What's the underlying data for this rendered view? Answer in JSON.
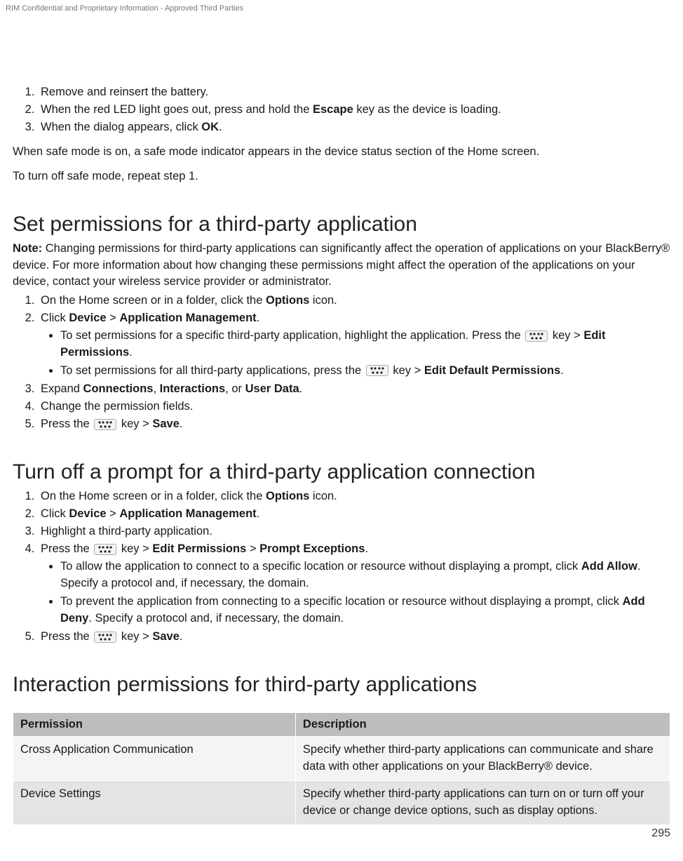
{
  "header": "RIM Confidential and Proprietary Information - Approved Third Parties",
  "footer_page": "295",
  "list1": {
    "i1": "Remove and reinsert the battery.",
    "i2a": "When the red LED light goes out, press and hold the ",
    "i2b": "Escape",
    "i2c": " key as the device is loading.",
    "i3a": "When the dialog appears, click ",
    "i3b": "OK",
    "i3c": "."
  },
  "para1": "When safe mode is on, a safe mode indicator appears in the device status section of the Home screen.",
  "para2": "To turn off safe mode, repeat step 1.",
  "sec2_title": "Set permissions for a third-party application",
  "sec2_note": {
    "label": "Note:",
    "text": " Changing permissions for third-party applications can significantly affect the operation of applications on your BlackBerry® device. For more information about how changing these permissions might affect the operation of the applications on your device, contact your wireless service provider or administrator."
  },
  "list2": {
    "i1a": "On the Home screen or in a folder, click the ",
    "i1b": "Options",
    "i1c": " icon.",
    "i2a": "Click ",
    "i2b": "Device",
    "i2c": " > ",
    "i2d": "Application Management",
    "i2e": ".",
    "bul1a": "To set permissions for a specific third-party application, highlight the application. Press the ",
    "bul1b": " key > ",
    "bul1c": "Edit Permissions",
    "bul1d": ".",
    "bul2a": "To set permissions for all third-party applications, press the ",
    "bul2b": " key > ",
    "bul2c": "Edit Default Permissions",
    "bul2d": ".",
    "i3a": "Expand ",
    "i3b": "Connections",
    "i3c": ", ",
    "i3d": "Interactions",
    "i3e": ", or ",
    "i3f": "User Data",
    "i3g": ".",
    "i4": "Change the permission fields.",
    "i5a": "Press the ",
    "i5b": " key > ",
    "i5c": "Save",
    "i5d": "."
  },
  "sec3_title": "Turn off a prompt for a third-party application connection",
  "list3": {
    "i1a": "On the Home screen or in a folder, click the ",
    "i1b": "Options",
    "i1c": " icon.",
    "i2a": "Click ",
    "i2b": "Device",
    "i2c": " > ",
    "i2d": "Application Management",
    "i2e": ".",
    "i3": "Highlight a third-party application.",
    "i4a": "Press the ",
    "i4b": " key > ",
    "i4c": "Edit Permissions",
    "i4d": " > ",
    "i4e": "Prompt Exceptions",
    "i4f": ".",
    "bul1a": "To allow the application to connect to a specific location or resource without displaying a prompt, click ",
    "bul1b": "Add Allow",
    "bul1c": ". Specify a protocol and, if necessary, the domain.",
    "bul2a": "To prevent the application from connecting to a specific location or resource without displaying a prompt, click ",
    "bul2b": "Add Deny",
    "bul2c": ". Specify a protocol and, if necessary, the domain.",
    "i5a": "Press the ",
    "i5b": " key > ",
    "i5c": "Save",
    "i5d": "."
  },
  "sec4_title": "Interaction permissions for third-party applications",
  "table": {
    "h1": "Permission",
    "h2": "Description",
    "r1c1": "Cross Application Communication",
    "r1c2": "Specify whether third-party applications can communicate and share data with other applications on your BlackBerry® device.",
    "r2c1": "Device Settings",
    "r2c2": "Specify whether third-party applications can turn on or turn off your device or change device options, such as display options."
  }
}
